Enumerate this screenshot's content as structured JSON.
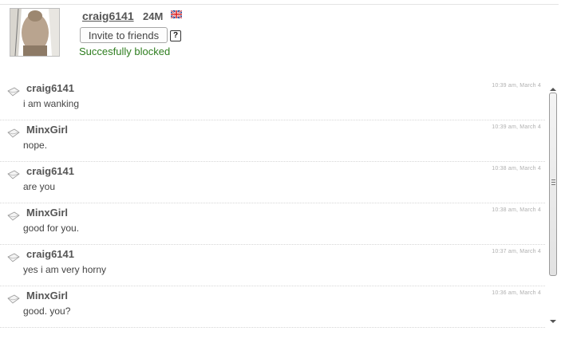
{
  "profile": {
    "username": "craig6141",
    "age_gender": "24M",
    "flag_icon": "uk-flag-icon",
    "invite_label": "Invite to friends",
    "help_label": "?",
    "status_message": "Succesfully blocked",
    "status_color": "#2e7d1e"
  },
  "messages": [
    {
      "sender": "craig6141",
      "time": "10:39 am, March 4",
      "text": "i am wanking"
    },
    {
      "sender": "MinxGirl",
      "time": "10:39 am, March 4",
      "text": "nope."
    },
    {
      "sender": "craig6141",
      "time": "10:38 am, March 4",
      "text": "are you"
    },
    {
      "sender": "MinxGirl",
      "time": "10:38 am, March 4",
      "text": "good for you."
    },
    {
      "sender": "craig6141",
      "time": "10:37 am, March 4",
      "text": "yes i am very horny"
    },
    {
      "sender": "MinxGirl",
      "time": "10:36 am, March 4",
      "text": "good. you?"
    }
  ]
}
